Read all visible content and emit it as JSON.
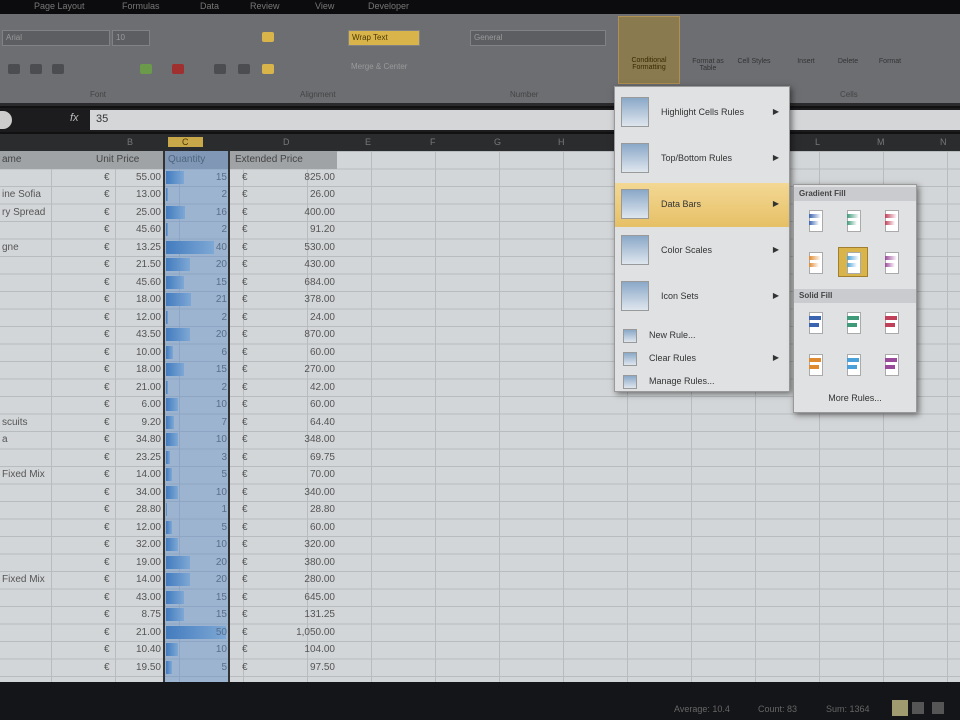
{
  "tabs": [
    "Page Layout",
    "Formulas",
    "Data",
    "Review",
    "View",
    "Developer"
  ],
  "ribbon": {
    "font_name": "Arial",
    "font_size": "10",
    "wrap_text": "Wrap Text",
    "merge_center": "Merge & Center",
    "number_format": "General",
    "groups": {
      "font": "Font",
      "alignment": "Alignment",
      "number": "Number",
      "cells": "Cells"
    },
    "cf_label": "Conditional Formatting",
    "format_table": "Format as Table",
    "cell_styles": "Cell Styles",
    "insert": "Insert",
    "delete": "Delete",
    "format": "Format"
  },
  "formula_bar": {
    "fx": "fx",
    "value": "35"
  },
  "columns": [
    "",
    "B",
    "C",
    "D",
    "E",
    "F",
    "G",
    "H",
    "L",
    "M",
    "N"
  ],
  "headers": [
    "ame",
    "Unit Price",
    "Quantity",
    "Extended Price"
  ],
  "currency": "€",
  "rows": [
    [
      "",
      "55.00",
      15,
      "825.00"
    ],
    [
      "ine Sofia",
      "13.00",
      2,
      "26.00"
    ],
    [
      "ry Spread",
      "25.00",
      16,
      "400.00"
    ],
    [
      "",
      "45.60",
      2,
      "91.20"
    ],
    [
      "gne",
      "13.25",
      40,
      "530.00"
    ],
    [
      "",
      "21.50",
      20,
      "430.00"
    ],
    [
      "",
      "45.60",
      15,
      "684.00"
    ],
    [
      "",
      "18.00",
      21,
      "378.00"
    ],
    [
      "",
      "12.00",
      2,
      "24.00"
    ],
    [
      "",
      "43.50",
      20,
      "870.00"
    ],
    [
      "",
      "10.00",
      6,
      "60.00"
    ],
    [
      "",
      "18.00",
      15,
      "270.00"
    ],
    [
      "",
      "21.00",
      2,
      "42.00"
    ],
    [
      "",
      "6.00",
      10,
      "60.00"
    ],
    [
      "scuits",
      "9.20",
      7,
      "64.40"
    ],
    [
      "a",
      "34.80",
      10,
      "348.00"
    ],
    [
      "",
      "23.25",
      3,
      "69.75"
    ],
    [
      "Fixed Mix",
      "14.00",
      5,
      "70.00"
    ],
    [
      "",
      "34.00",
      10,
      "340.00"
    ],
    [
      "",
      "28.80",
      1,
      "28.80"
    ],
    [
      "",
      "12.00",
      5,
      "60.00"
    ],
    [
      "",
      "32.00",
      10,
      "320.00"
    ],
    [
      "",
      "19.00",
      20,
      "380.00"
    ],
    [
      "Fixed Mix",
      "14.00",
      20,
      "280.00"
    ],
    [
      "",
      "43.00",
      15,
      "645.00"
    ],
    [
      "",
      "8.75",
      15,
      "131.25"
    ],
    [
      "",
      "21.00",
      50,
      "1,050.00"
    ],
    [
      "",
      "10.40",
      10,
      "104.00"
    ],
    [
      "",
      "19.50",
      5,
      "97.50"
    ]
  ],
  "bar_max": 50,
  "menu": {
    "items": [
      "Highlight Cells Rules",
      "Top/Bottom Rules",
      "Data Bars",
      "Color Scales",
      "Icon Sets"
    ],
    "small_items": [
      "New Rule...",
      "Clear Rules",
      "Manage Rules..."
    ]
  },
  "submenu": {
    "gradient": "Gradient Fill",
    "solid": "Solid Fill",
    "more": "More Rules...",
    "colors": [
      "#3a64b0",
      "#3f9a7a",
      "#c0405a",
      "#e08a30",
      "#4aa0d8",
      "#9a4a9a"
    ]
  },
  "status": {
    "average": "Average: 10.4",
    "count": "Count: 83",
    "sum": "Sum: 1364"
  }
}
